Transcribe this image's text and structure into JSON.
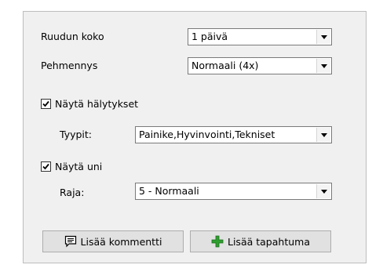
{
  "settings": {
    "grid_size": {
      "label": "Ruudun koko",
      "value": "1 päivä"
    },
    "smoothing": {
      "label": "Pehmennys",
      "value": "Normaali (4x)"
    }
  },
  "alerts": {
    "show_label": "Näytä hälytykset",
    "checked": true,
    "types_label": "Tyypit:",
    "types_value": "Painike,Hyvinvointi,Tekniset"
  },
  "sleep": {
    "show_label": "Näytä uni",
    "checked": true,
    "limit_label": "Raja:",
    "limit_value": "5 - Normaali"
  },
  "buttons": {
    "add_comment": {
      "label": "Lisää kommentti",
      "icon": "comment-icon"
    },
    "add_event": {
      "label": "Lisää tapahtuma",
      "icon": "plus-icon",
      "icon_color": "#2e9e2e"
    }
  }
}
